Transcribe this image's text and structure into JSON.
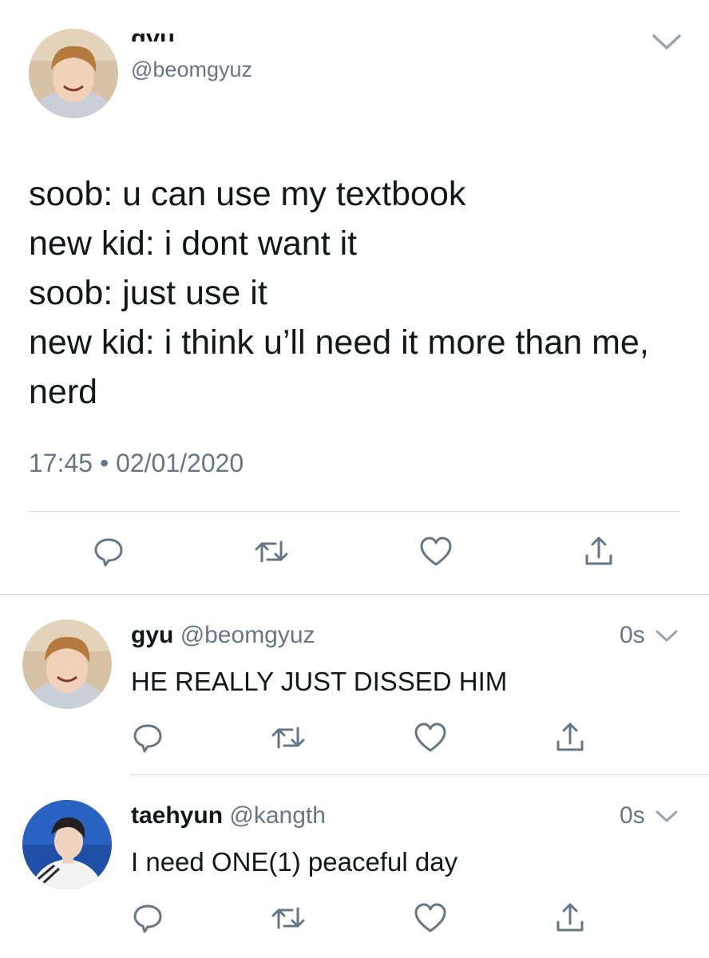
{
  "main_tweet": {
    "display_name": "gyu",
    "handle": "@beomgyuz",
    "text": "soob: u can use my textbook\nnew kid: i dont want it\nsoob: just use it\nnew kid: i think u’ll need it more than me, nerd",
    "timestamp": "17:45 • 02/01/2020"
  },
  "replies": [
    {
      "display_name": "gyu",
      "handle": "@beomgyuz",
      "time": "0s",
      "text": "HE REALLY JUST DISSED HIM"
    },
    {
      "display_name": "taehyun",
      "handle": "@kangth",
      "time": "0s",
      "text": "I need ONE(1) peaceful day"
    }
  ],
  "icons": [
    "reply-icon",
    "retweet-icon",
    "like-icon",
    "share-icon",
    "chevron-down-icon"
  ],
  "colors": {
    "text": "#14171a",
    "secondary": "#657786",
    "divider": "#d4d9de",
    "icon": "#657786"
  }
}
